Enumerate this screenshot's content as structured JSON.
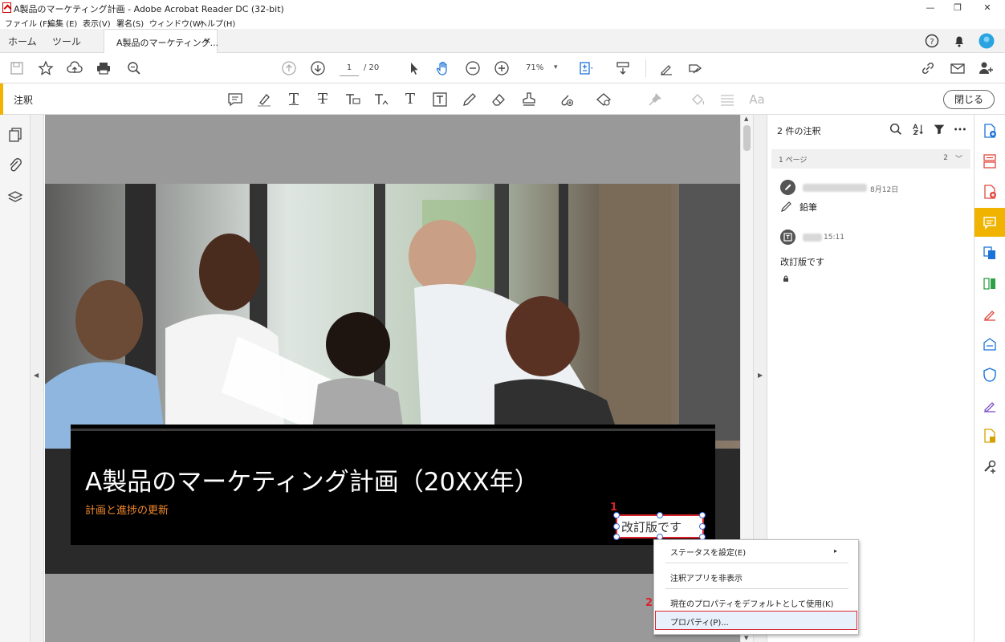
{
  "window": {
    "title": "A製品のマーケティング計画 - Adobe Acrobat Reader DC (32-bit)",
    "minimize": "—",
    "restore": "❐",
    "close": "✕"
  },
  "menu": [
    "ファイル (F)",
    "編集 (E)",
    "表示(V)",
    "署名(S)",
    "ウィンドウ(W)",
    "ヘルプ(H)"
  ],
  "tabs": {
    "home": "ホーム",
    "tools": "ツール",
    "document": "A製品のマーケティング...",
    "close": "×"
  },
  "toolbar": {
    "page_current": "1",
    "page_total": "/ 20",
    "zoom": "71%",
    "zoom_arrow": "▾"
  },
  "comment_toolbar": {
    "label": "注釈",
    "close_button": "閉じる",
    "text_glyph": "T",
    "font_glyph": "Aa"
  },
  "slide": {
    "title": "A製品のマーケティング計画（20XX年）",
    "subtitle": "計画と進捗の更新",
    "textbox": "改訂版です"
  },
  "markers": {
    "first": "1",
    "second": "2"
  },
  "panel": {
    "title": "2 件の注釈",
    "section_label": "1 ページ",
    "section_count": "2",
    "section_chevron": "﹀",
    "comments": [
      {
        "time": "8月12日",
        "text": "鉛筆"
      },
      {
        "time": "15:11",
        "text": "改訂版です"
      }
    ]
  },
  "context_menu": {
    "items": [
      "ステータスを設定(E)",
      "注釈アプリを非表示",
      "現在のプロパティをデフォルトとして使用(K)",
      "プロパティ(P)..."
    ],
    "submenu_arrow": "▸"
  },
  "colors": {
    "accent": "#f0b400",
    "highlight_border": "#d9232d",
    "subtitle": "#f28a2c"
  }
}
